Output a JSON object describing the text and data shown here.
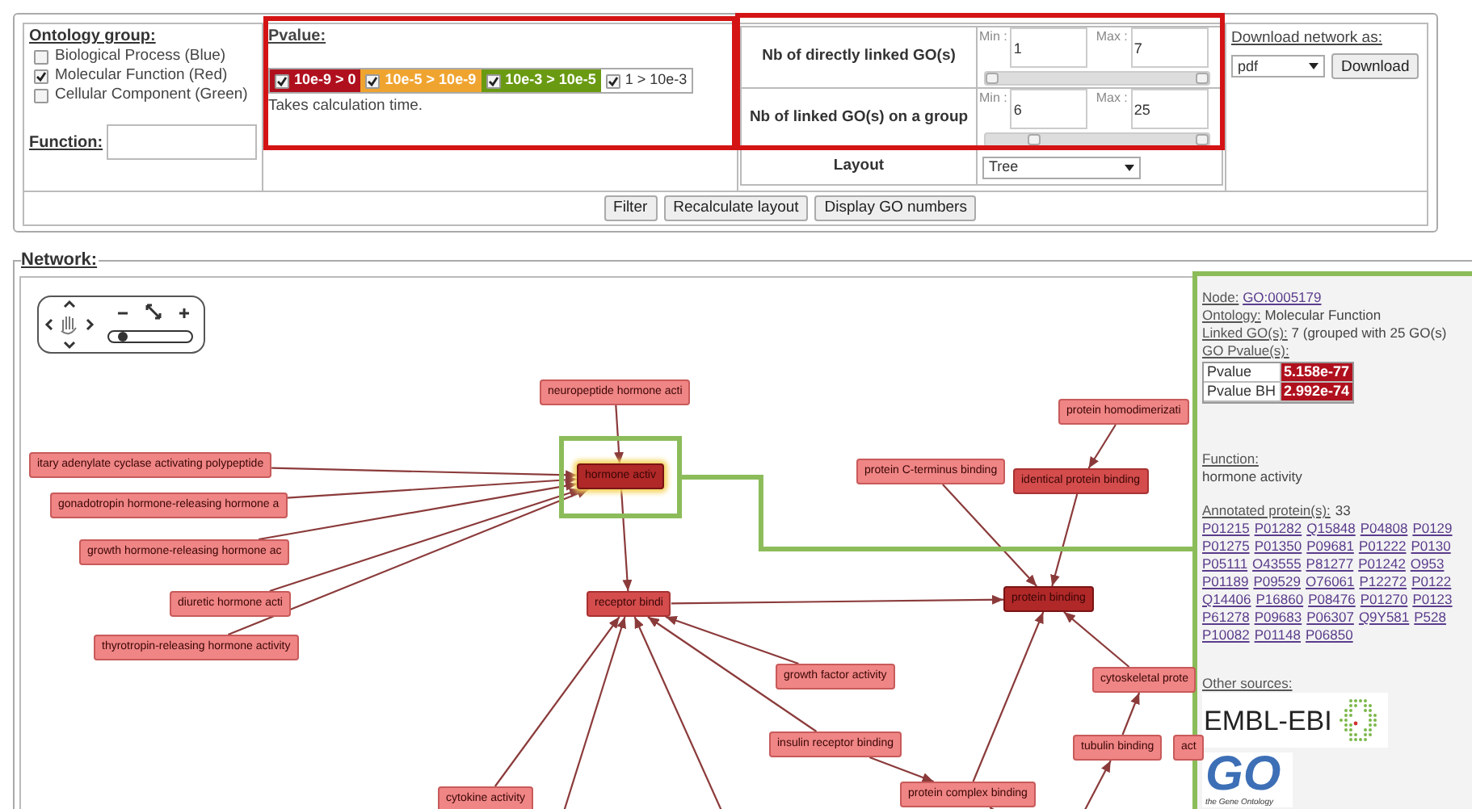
{
  "ontology_group": {
    "title": "Ontology group:",
    "options": [
      {
        "label": "Biological Process (Blue)",
        "checked": false
      },
      {
        "label": "Molecular Function (Red)",
        "checked": true
      },
      {
        "label": "Cellular Component (Green)",
        "checked": false
      }
    ]
  },
  "function_filter": {
    "label": "Function:"
  },
  "pvalue": {
    "title": "Pvalue:",
    "ranges": [
      {
        "label": "10e-9 > 0",
        "checked": true,
        "color": "#b0101e"
      },
      {
        "label": "10e-5 > 10e-9",
        "checked": true,
        "color": "#f0a430"
      },
      {
        "label": "10e-3 > 10e-5",
        "checked": true,
        "color": "#6a9a12"
      },
      {
        "label": "1 > 10e-3",
        "checked": true,
        "color": "#ffffff"
      }
    ],
    "note": "Takes calculation time."
  },
  "linked_filters": [
    {
      "label": "Nb of directly linked GO(s)",
      "min_label": "Min :",
      "min": "1",
      "max_label": "Max :",
      "max": "7",
      "handles": [
        {
          "level": 0
        },
        {
          "level": 1
        }
      ]
    },
    {
      "label": "Nb of linked GO(s) on a group",
      "min_label": "Min :",
      "min": "6",
      "max_label": "Max :",
      "max": "25",
      "handles": [
        {
          "level": 0.2
        },
        {
          "level": 1
        }
      ]
    }
  ],
  "layout": {
    "label": "Layout",
    "value": "Tree"
  },
  "download": {
    "title": "Download network as:",
    "format": "pdf",
    "button": "Download"
  },
  "buttons": [
    "Filter",
    "Recalculate layout",
    "Display GO numbers"
  ],
  "network": {
    "legend": "Network:",
    "nodes": [
      {
        "label": "neuropeptide hormone acti",
        "kind": "light",
        "selected": false
      },
      {
        "label": "hormone activ",
        "kind": "dark",
        "selected": true
      },
      {
        "label": "itary adenylate cyclase activating polypeptide",
        "kind": "light",
        "selected": false
      },
      {
        "label": "gonadotropin hormone-releasing hormone a",
        "kind": "light",
        "selected": false
      },
      {
        "label": "growth hormone-releasing hormone ac",
        "kind": "light",
        "selected": false
      },
      {
        "label": "diuretic hormone acti",
        "kind": "light",
        "selected": false
      },
      {
        "label": "thyrotropin-releasing hormone activity",
        "kind": "light",
        "selected": false
      },
      {
        "label": "receptor bindi",
        "kind": "medium",
        "selected": false
      },
      {
        "label": "protein C-terminus binding",
        "kind": "light",
        "selected": false
      },
      {
        "label": "protein homodimerizati",
        "kind": "light",
        "selected": false
      },
      {
        "label": "identical protein binding",
        "kind": "medium",
        "selected": false
      },
      {
        "label": "protein binding",
        "kind": "dark",
        "selected": false
      },
      {
        "label": "growth factor activity",
        "kind": "light",
        "selected": false
      },
      {
        "label": "insulin receptor binding",
        "kind": "light",
        "selected": false
      },
      {
        "label": "cytokine activity",
        "kind": "light",
        "selected": false
      },
      {
        "label": "protein complex binding",
        "kind": "light",
        "selected": false
      },
      {
        "label": "cytoskeletal prote",
        "kind": "light",
        "selected": false
      },
      {
        "label": "tubulin binding",
        "kind": "light",
        "selected": false
      },
      {
        "label": "act",
        "kind": "light",
        "selected": false
      }
    ]
  },
  "node_info": {
    "fields": [
      {
        "label": "Node:",
        "value": "GO:0005179",
        "kind": "link"
      },
      {
        "label": "Ontology:",
        "value": "Molecular Function",
        "kind": "text"
      },
      {
        "label": "Linked GO(s):",
        "value": "7 (grouped with 25 GO(s)",
        "kind": "text"
      }
    ],
    "pvalue_title": "GO Pvalue(s):",
    "pvalues": [
      {
        "label": "Pvalue",
        "value": "5.158e-77"
      },
      {
        "label": "Pvalue BH",
        "value": "2.992e-74"
      }
    ],
    "function_label": "Function:",
    "function": "hormone activity",
    "proteins_label": "Annotated protein(s):",
    "protein_count": "33",
    "protein_rows": [
      [
        "P01215",
        "P01282",
        "Q15848",
        "P04808",
        "P0129"
      ],
      [
        "P01275",
        "P01350",
        "P09681",
        "P01222",
        "P0130"
      ],
      [
        "P05111",
        "O43555",
        "P81277",
        "P01242",
        "O953"
      ],
      [
        "P01189",
        "P09529",
        "O76061",
        "P12272",
        "P0122"
      ],
      [
        "Q14406",
        "P16860",
        "P08476",
        "P01270",
        "P0123"
      ],
      [
        "P61278",
        "P09683",
        "P06307",
        "Q9Y581",
        "P528"
      ],
      [
        "P10082",
        "P01148",
        "P06850"
      ]
    ],
    "other_sources_label": "Other sources:",
    "sources": [
      {
        "kind": "ebi",
        "name": "EMBL-EBI"
      },
      {
        "kind": "go",
        "name": "GO",
        "caption": "the Gene Ontology"
      }
    ]
  }
}
